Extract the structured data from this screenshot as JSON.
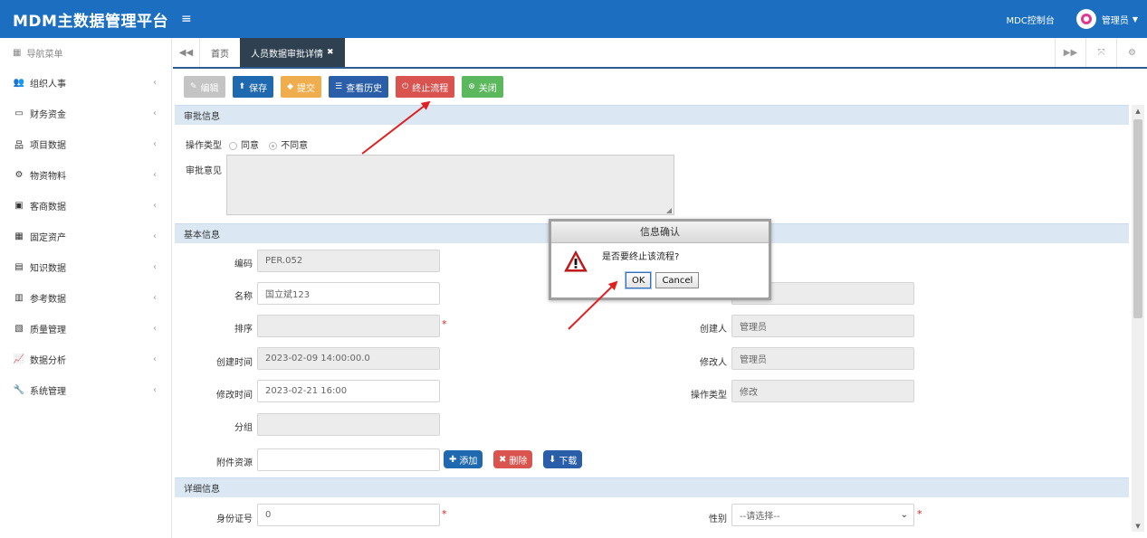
{
  "app": {
    "title": "MDM主数据管理平台",
    "console": "MDC控制台",
    "user": "管理员"
  },
  "sidebar": {
    "header": "导航菜单",
    "items": [
      {
        "label": "组织人事",
        "icon": "users-icon",
        "glyph": "👥"
      },
      {
        "label": "财务资金",
        "icon": "credit-card-icon",
        "glyph": "▭"
      },
      {
        "label": "项目数据",
        "icon": "sitemap-icon",
        "glyph": "品"
      },
      {
        "label": "物资物料",
        "icon": "cubes-icon",
        "glyph": "⚙"
      },
      {
        "label": "客商数据",
        "icon": "briefcase-icon",
        "glyph": "▣"
      },
      {
        "label": "固定资产",
        "icon": "building-icon",
        "glyph": "▦"
      },
      {
        "label": "知识数据",
        "icon": "book-icon",
        "glyph": "▤"
      },
      {
        "label": "参考数据",
        "icon": "table-icon",
        "glyph": "▥"
      },
      {
        "label": "质量管理",
        "icon": "list-icon",
        "glyph": "▧"
      },
      {
        "label": "数据分析",
        "icon": "line-chart-icon",
        "glyph": "📈"
      },
      {
        "label": "系统管理",
        "icon": "wrench-icon",
        "glyph": "🔧"
      }
    ]
  },
  "tabs": {
    "home": "首页",
    "active": "人员数据审批详情"
  },
  "toolbar": {
    "edit": "编辑",
    "save": "保存",
    "submit": "提交",
    "history": "查看历史",
    "terminate": "终止流程",
    "close": "关闭"
  },
  "approval": {
    "section": "审批信息",
    "op_label": "操作类型",
    "opt_agree": "同意",
    "opt_disagree": "不同意",
    "opinion_label": "审批意见"
  },
  "basic": {
    "section": "基本信息",
    "code_label": "编码",
    "code": "PER.052",
    "name_label": "名称",
    "name": "国立斌123",
    "order_label": "排序",
    "created_label": "创建时间",
    "created": "2023-02-09 14:00:00.0",
    "modified_label": "修改时间",
    "modified": "2023-02-21 16:00",
    "group_label": "分组",
    "attach_label": "附件资源",
    "add": "添加",
    "delete": "删除",
    "download": "下载",
    "creator_label": "创建人",
    "creator": "管理员",
    "modifier_label": "修改人",
    "modifier": "管理员",
    "optype_label": "操作类型",
    "optype": "修改"
  },
  "detail": {
    "section": "详细信息",
    "id_label": "身份证号",
    "id": "0",
    "gender_label": "性别",
    "gender": "--请选择--"
  },
  "dialog": {
    "title": "信息确认",
    "message": "是否要终止该流程?",
    "ok": "OK",
    "cancel": "Cancel"
  },
  "colors": {
    "header": "#1c6fc0",
    "section": "#dbe8f4",
    "annotation": "#e02020"
  }
}
